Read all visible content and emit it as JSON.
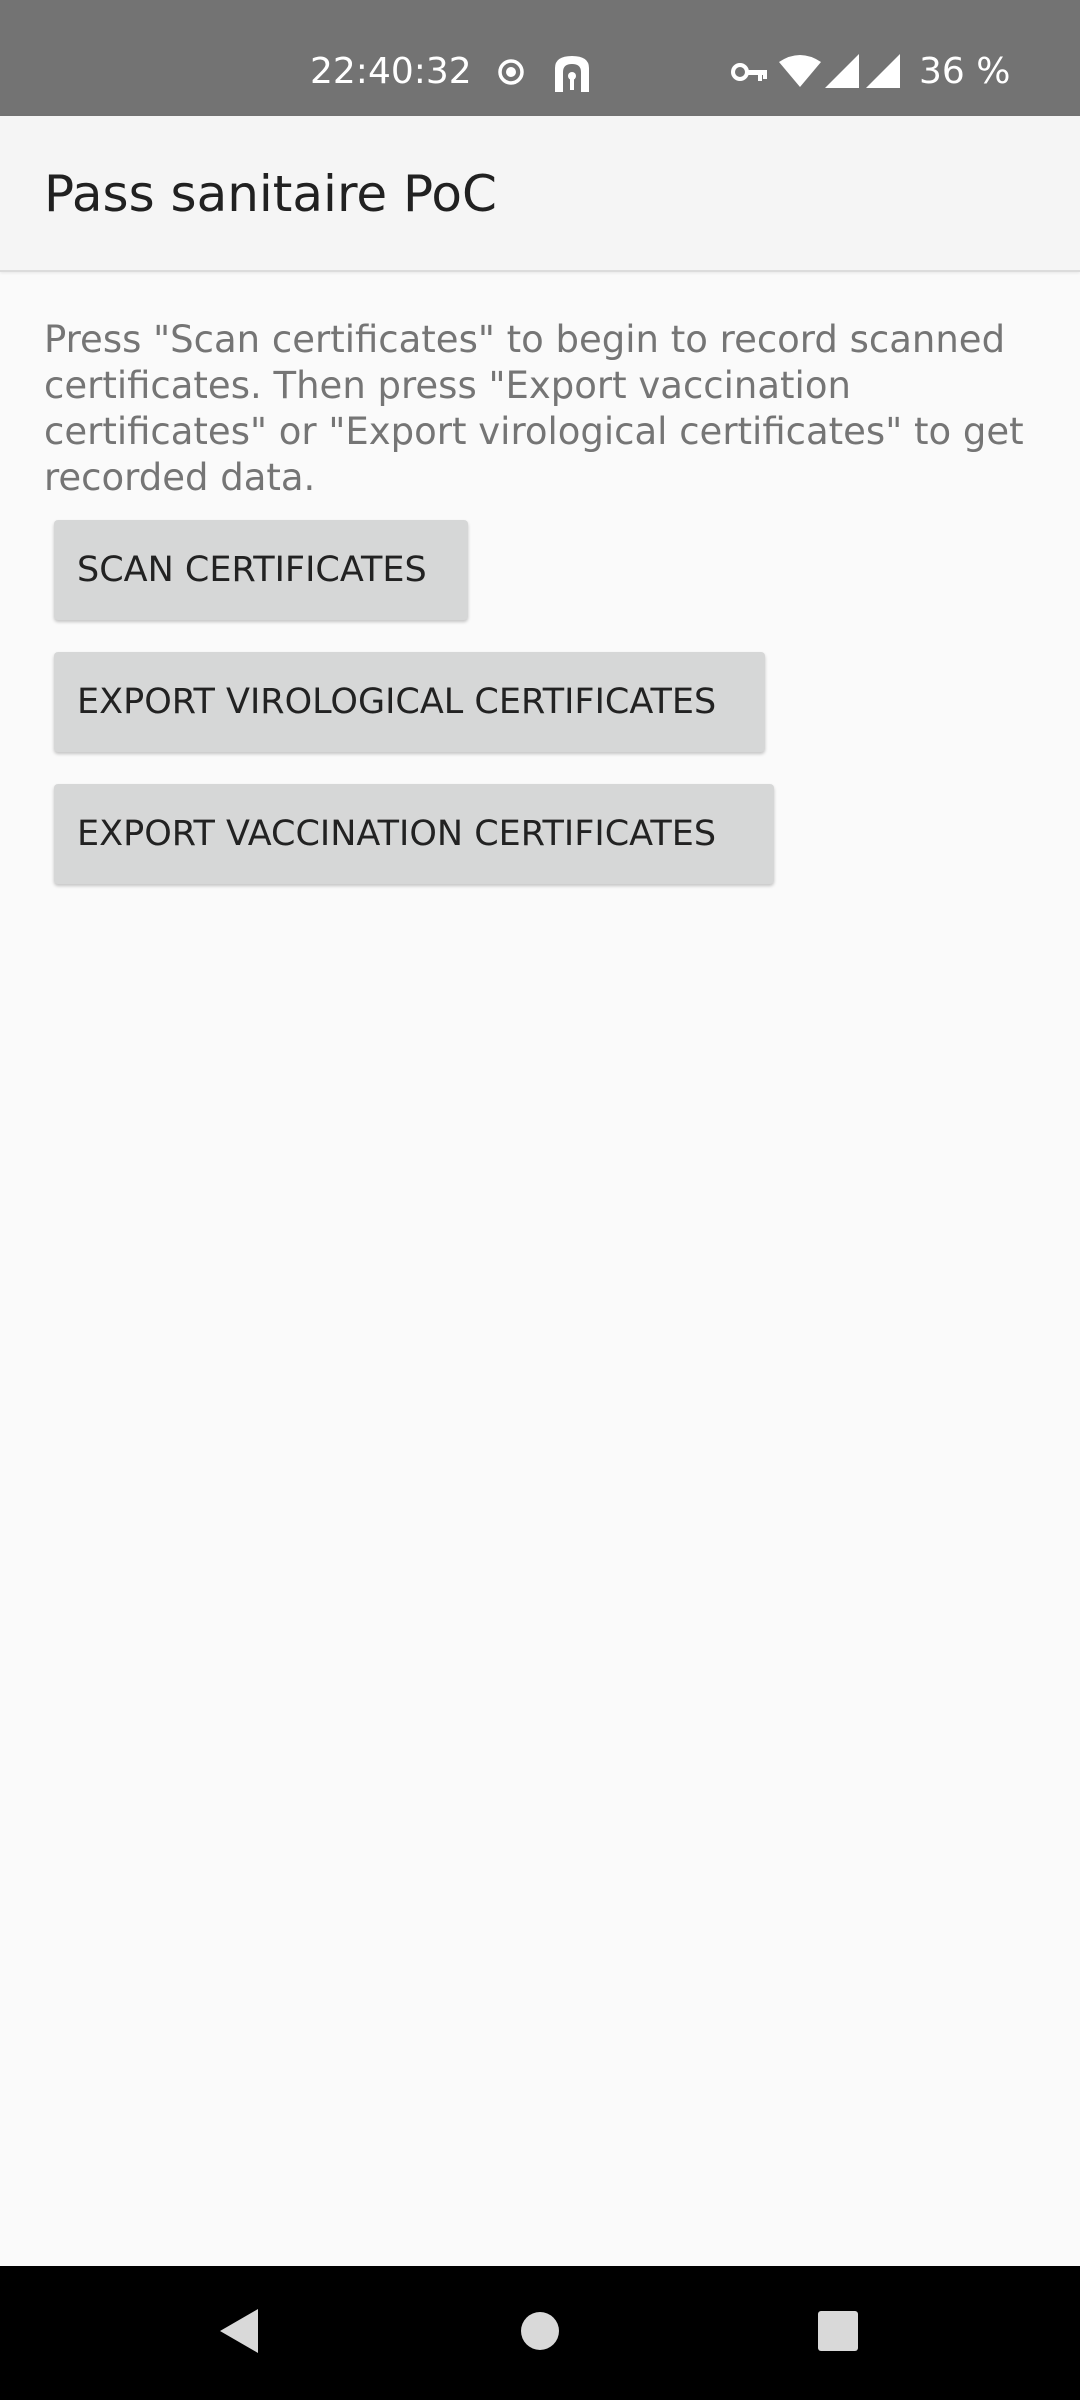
{
  "status_bar": {
    "time": "22:40:32",
    "battery": "36 %",
    "icons": [
      "record-icon",
      "privacy-alert-icon",
      "vpn-key-icon",
      "wifi-icon",
      "signal-icon",
      "signal-icon-2"
    ]
  },
  "app_bar": {
    "title": "Pass sanitaire PoC"
  },
  "main": {
    "description": "Press \"Scan certificates\" to begin to record scanned certificates. Then press \"Export vaccination certificates\" or \"Export virological certificates\" to get recorded data.",
    "buttons": {
      "scan": "SCAN CERTIFICATES",
      "export_virological": "EXPORT VIROLOGICAL CERTIFICATES",
      "export_vaccination": "EXPORT VACCINATION CERTIFICATES"
    }
  },
  "nav_bar": {
    "icons": [
      "back-icon",
      "home-icon",
      "recents-icon"
    ]
  },
  "colors": {
    "status_bar": "#737373",
    "app_bar": "#f5f5f5",
    "background": "#fafafa",
    "button": "#d6d7d7",
    "nav_bar": "#000000"
  }
}
